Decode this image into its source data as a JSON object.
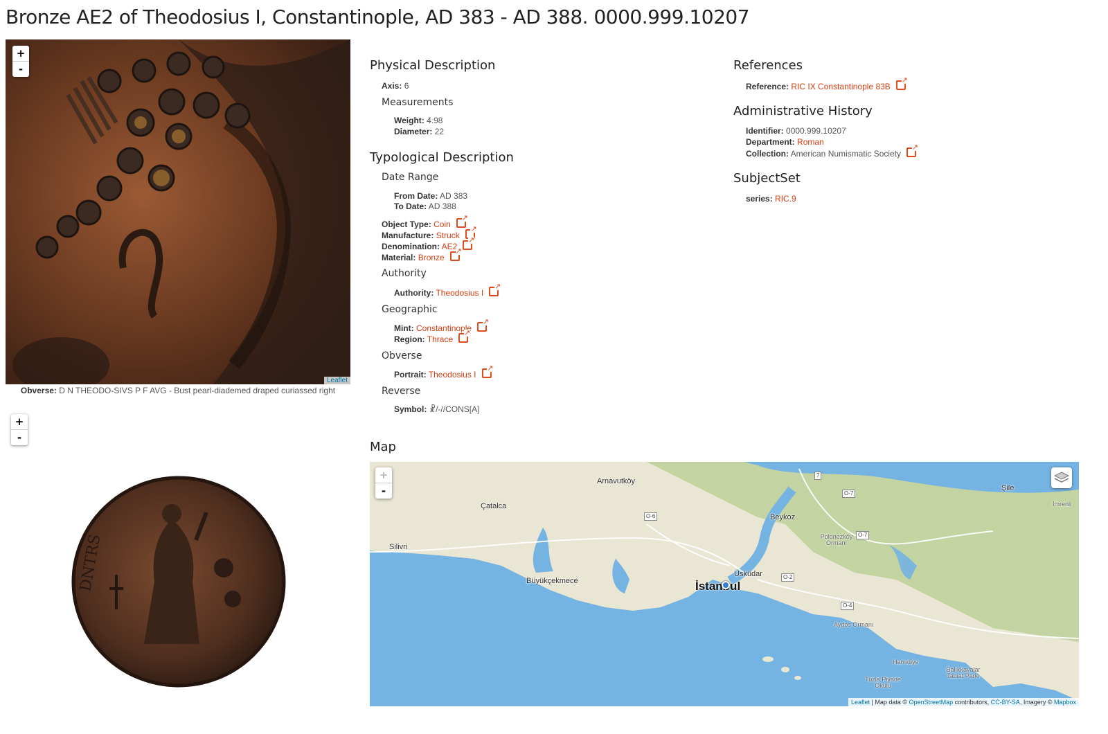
{
  "title": "Bronze AE2 of Theodosius I, Constantinople, AD 383 - AD 388. 0000.999.10207",
  "viewer": {
    "zoom_in": "+",
    "zoom_out": "-",
    "attribution": "Leaflet"
  },
  "obverse_caption": {
    "label": "Obverse:",
    "text": "D N THEODO-SIVS P F AVG - Bust pearl-diademed draped curiassed right"
  },
  "physical": {
    "heading": "Physical Description",
    "axis_label": "Axis:",
    "axis_value": "6",
    "measurements_heading": "Measurements",
    "weight_label": "Weight:",
    "weight_value": "4.98",
    "diameter_label": "Diameter:",
    "diameter_value": "22"
  },
  "typological": {
    "heading": "Typological Description",
    "date_range_heading": "Date Range",
    "from_label": "From Date:",
    "from_value": "AD 383",
    "to_label": "To Date:",
    "to_value": "AD 388",
    "object_type_label": "Object Type:",
    "object_type_value": "Coin",
    "manufacture_label": "Manufacture:",
    "manufacture_value": "Struck",
    "denomination_label": "Denomination:",
    "denomination_value": "AE2",
    "material_label": "Material:",
    "material_value": "Bronze",
    "authority_heading": "Authority",
    "authority_label": "Authority:",
    "authority_value": "Theodosius I",
    "geographic_heading": "Geographic",
    "mint_label": "Mint:",
    "mint_value": "Constantinople",
    "region_label": "Region:",
    "region_value": "Thrace",
    "obverse_heading": "Obverse",
    "portrait_label": "Portrait:",
    "portrait_value": "Theodosius I",
    "reverse_heading": "Reverse",
    "symbol_label": "Symbol:",
    "symbol_value": "☧/-//CONS[A]"
  },
  "references": {
    "heading": "References",
    "reference_label": "Reference:",
    "reference_value": "RIC IX Constantinople 83B"
  },
  "admin": {
    "heading": "Administrative History",
    "identifier_label": "Identifier:",
    "identifier_value": "0000.999.10207",
    "department_label": "Department:",
    "department_value": "Roman",
    "collection_label": "Collection:",
    "collection_value": "American Numismatic Society"
  },
  "subjectset": {
    "heading": "SubjectSet",
    "series_label": "series:",
    "series_value": "RIC.9"
  },
  "map": {
    "heading": "Map",
    "zoom_in": "+",
    "zoom_out": "-",
    "places": {
      "arnavutkoy": "Arnavutköy",
      "catalca": "Çatalca",
      "beykoz": "Beykoz",
      "sile": "Şile",
      "imrenli": "İmrenli",
      "silivri": "Silivri",
      "polonezkoy": "Polonezköy Ormanı",
      "buyukcekmece": "Büyükçekmece",
      "istanbul": "İstanbul",
      "uskudar": "Üsküdar",
      "aydos": "Aydos Ormanı",
      "hamidiye": "Hamidiye",
      "balikayalar": "Balıkkayalar Tabiat Parkı",
      "tuzla": "Tuzla Piyade Okulu"
    },
    "roads": {
      "r7a": "7",
      "o7a": "O-7",
      "o6": "O-6",
      "o7b": "O-7",
      "o2": "O-2",
      "o4": "O-4"
    },
    "attribution": {
      "leaflet": "Leaflet",
      "sep": " | Map data © ",
      "osm": "OpenStreetMap",
      "contrib": " contributors, ",
      "ccbysa": "CC-BY-SA",
      "imagery": ", Imagery © ",
      "mapbox": "Mapbox"
    }
  }
}
